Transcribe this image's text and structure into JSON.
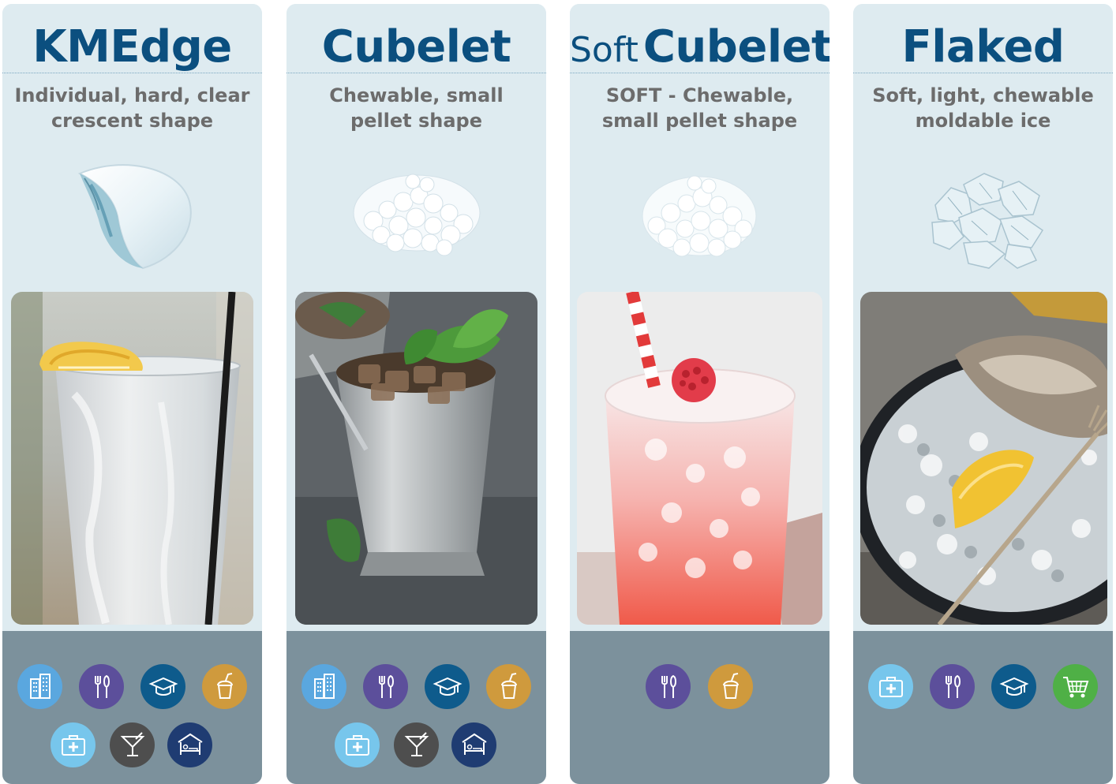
{
  "colors": {
    "title": "#0b4f7f",
    "subtitle": "#6c6c6c",
    "panel": "#deebf0",
    "footer": "#7c919c",
    "icon_building": "#5aa7df",
    "icon_dining": "#5c4f9b",
    "icon_education": "#0e5b8c",
    "icon_beverage": "#cf9a3d",
    "icon_healthcare": "#77c6ec",
    "icon_bar": "#4e4e4e",
    "icon_lodging": "#1f3c72",
    "icon_retail": "#4fb046"
  },
  "products": [
    {
      "title": "KMEdge",
      "subtitle_line1": "Individual, hard, clear",
      "subtitle_line2": "crescent shape",
      "icons": [
        "building-icon",
        "dining-icon",
        "education-icon",
        "beverage-icon",
        "healthcare-icon",
        "cocktail-icon",
        "lodging-icon"
      ]
    },
    {
      "title": "Cubelet",
      "subtitle_line1": "Chewable, small",
      "subtitle_line2": "pellet shape",
      "icons": [
        "building-icon",
        "dining-icon",
        "education-icon",
        "beverage-icon",
        "healthcare-icon",
        "cocktail-icon",
        "lodging-icon"
      ]
    },
    {
      "title_prefix": "Soft",
      "title": "Cubelet",
      "subtitle_line1": "SOFT - Chewable,",
      "subtitle_line2": "small pellet shape",
      "icons": [
        "dining-icon",
        "beverage-icon"
      ]
    },
    {
      "title": "Flaked",
      "subtitle_line1": "Soft, light, chewable",
      "subtitle_line2": "moldable ice",
      "icons": [
        "healthcare-icon",
        "dining-icon",
        "education-icon",
        "shopping-cart-icon"
      ]
    }
  ]
}
